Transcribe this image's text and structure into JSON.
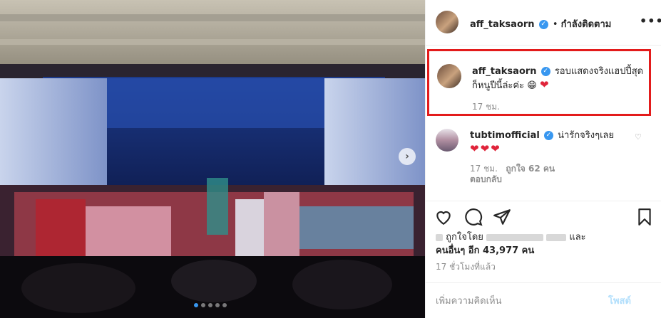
{
  "header": {
    "username": "aff_taksaorn",
    "separator": "•",
    "follow_label": "กำลังติดตาม",
    "more_label": "•••"
  },
  "caption": {
    "username": "aff_taksaorn",
    "text": "รอบแสดงจริงแฮปปี้สุดก็หนูปีนี้ล่ะค่ะ",
    "emoji": "😁",
    "heart": "❤",
    "time": "17 ชม."
  },
  "comment": {
    "username": "tubtimofficial",
    "text": "น่ารักจริงๆเลย",
    "hearts": "❤❤❤",
    "time": "17 ชม.",
    "likes": "ถูกใจ 62 คน",
    "reply_label": "ตอบกลับ"
  },
  "likes": {
    "prefix": "ถูกใจโดย",
    "conj": "และ",
    "others_label": "คนอื่นๆ อีก 43,977 คน"
  },
  "posted_ago": "17 ชั่วโมงที่แล้ว",
  "add_comment": {
    "placeholder": "เพิ่มความคิดเห็น",
    "post_label": "โพสต์"
  },
  "carousel": {
    "next_label": "›",
    "dots_count": 5,
    "active_index": 0
  },
  "colors": {
    "verified": "#3897f0",
    "highlight_border": "#e31b1b",
    "heart": "#e0243a",
    "post_disabled": "#b2dffc"
  }
}
